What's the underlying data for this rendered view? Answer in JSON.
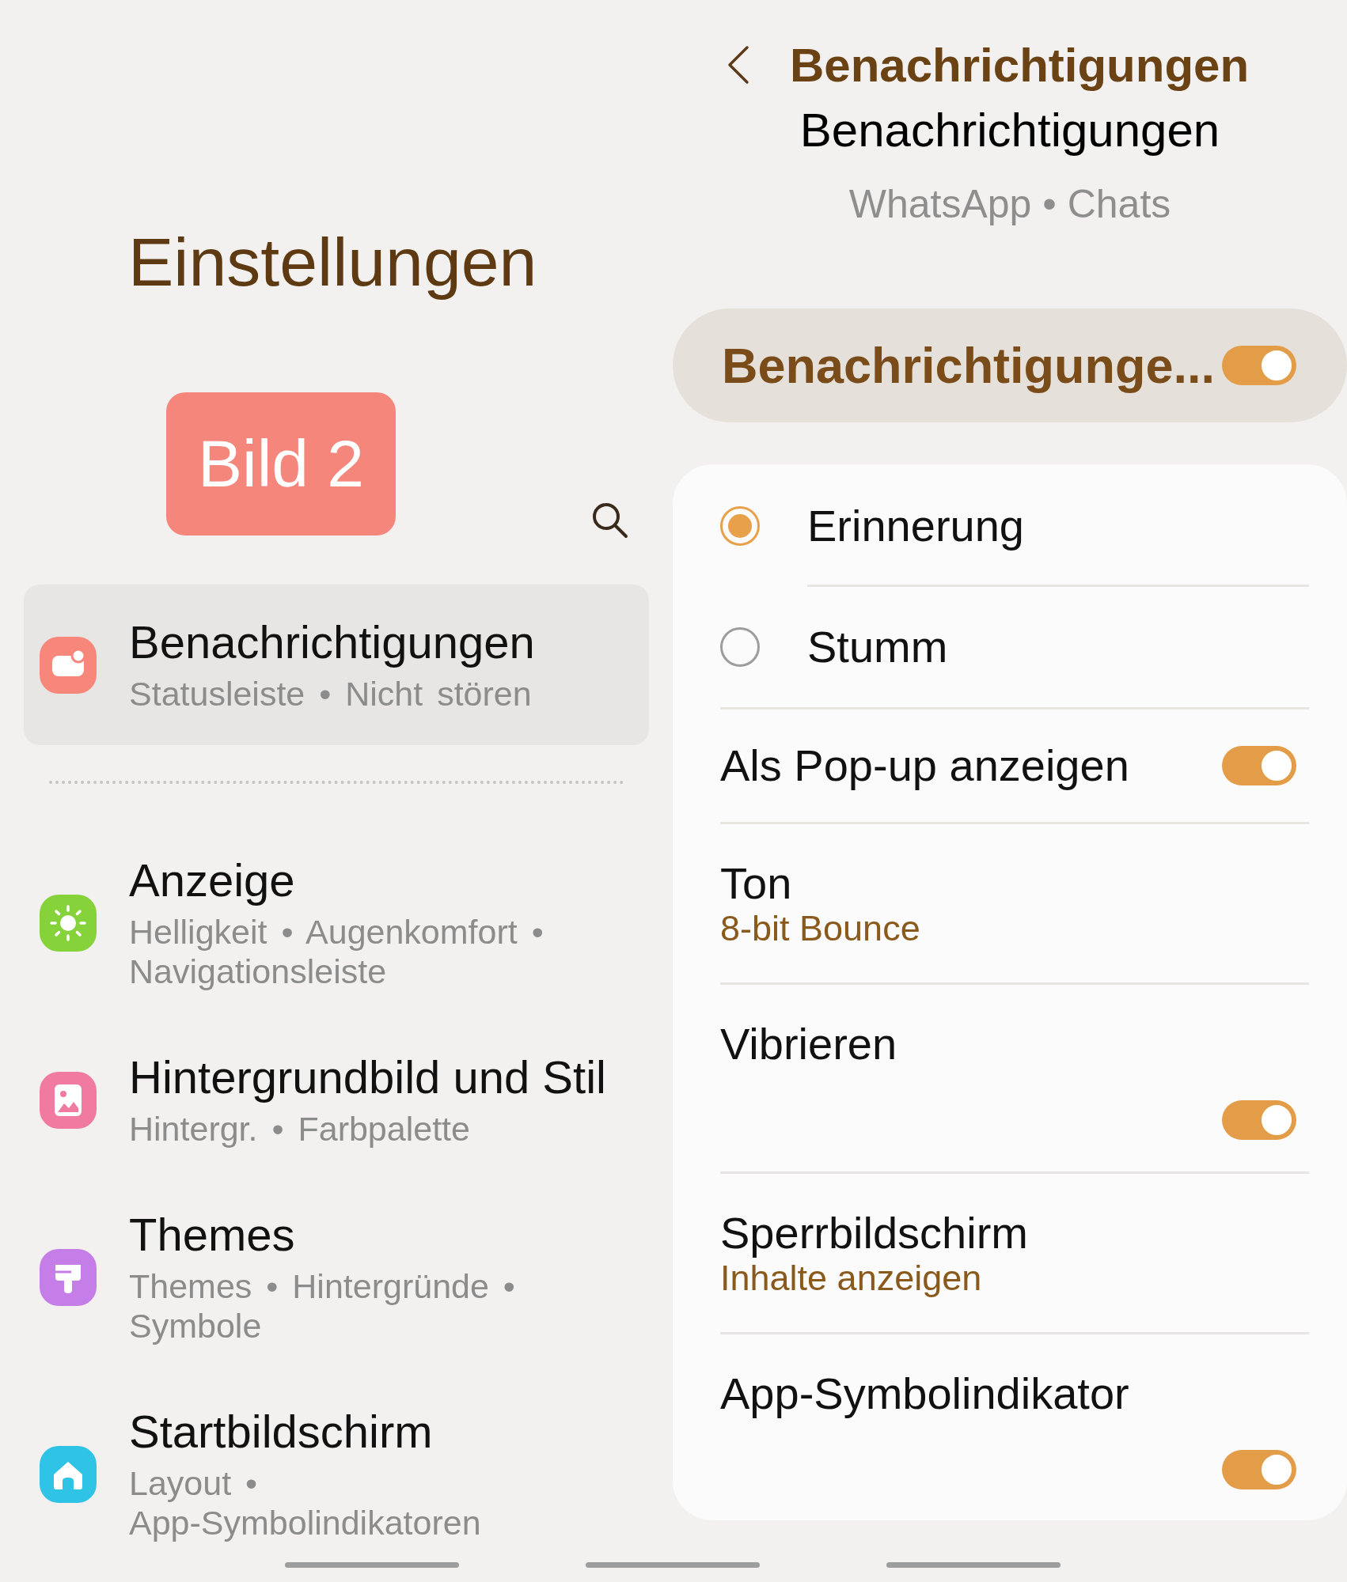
{
  "settings": {
    "title": "Einstellungen",
    "badge": "Bild 2",
    "items": [
      {
        "kind": "notifications",
        "title": "Benachrichtigungen",
        "subtitle_lines": [
          "Statusleiste • Nicht stören"
        ],
        "selected": true,
        "color": "#f7877a"
      },
      {
        "kind": "display",
        "title": "Anzeige",
        "subtitle_lines": [
          "Helligkeit • Augenkomfort •",
          "Navigationsleiste"
        ],
        "selected": false,
        "color": "#86d23a"
      },
      {
        "kind": "wallpaper",
        "title": "Hintergrundbild und Stil",
        "subtitle_lines": [
          "Hintergr. • Farbpalette"
        ],
        "selected": false,
        "color": "#f07aa0"
      },
      {
        "kind": "themes",
        "title": "Themes",
        "subtitle_lines": [
          "Themes • Hintergründe •",
          "Symbole"
        ],
        "selected": false,
        "color": "#c57de8"
      },
      {
        "kind": "home",
        "title": "Startbildschirm",
        "subtitle_lines": [
          "Layout •",
          "App-Symbolindikatoren"
        ],
        "selected": false,
        "color": "#2fc3e6"
      }
    ]
  },
  "notifications": {
    "header_title": "Benachrichtigungen",
    "scrolled_heading": "Benachrichtigungen",
    "subtitle": "WhatsApp • Chats",
    "master": {
      "label": "Benachrichtigunge...",
      "on": true
    },
    "rows": [
      {
        "kind": "radio",
        "label": "Erinnerung",
        "selected": true
      },
      {
        "kind": "radio",
        "label": "Stumm",
        "selected": false
      },
      {
        "kind": "toggle",
        "label": "Als Pop-up anzeigen",
        "on": true
      },
      {
        "kind": "value",
        "label": "Ton",
        "value": "8-bit Bounce"
      },
      {
        "kind": "toggle_below",
        "label": "Vibrieren",
        "on": true
      },
      {
        "kind": "value",
        "label": "Sperrbildschirm",
        "value": "Inhalte anzeigen"
      },
      {
        "kind": "toggle_below",
        "label": "App-Symbolindikator",
        "on": true
      }
    ]
  }
}
